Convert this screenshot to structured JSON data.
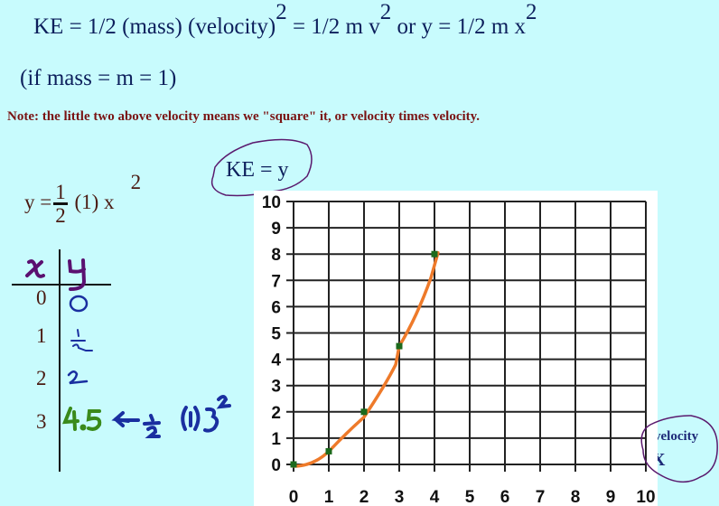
{
  "header": {
    "equation_parts": [
      "KE = 1/2 (mass)  (velocity)",
      "2",
      " = 1/2  m v",
      "2",
      "  or  y = 1/2 m x",
      "2"
    ],
    "condition": "(if mass = m = 1)",
    "note": "Note: the little two above velocity means we \"square\" it, or velocity times velocity."
  },
  "formula": {
    "lhs": "y =",
    "numerator": "1",
    "denominator": "2",
    "rest": "(1) x",
    "exponent": "2"
  },
  "table": {
    "headers": [
      "x",
      "y"
    ],
    "rows": [
      {
        "x": "0",
        "y": "0"
      },
      {
        "x": "1",
        "y": "1/2"
      },
      {
        "x": "2",
        "y": "2"
      },
      {
        "x": "3",
        "y": "4.5"
      }
    ],
    "annotation": "← ½ (1) 3²"
  },
  "colors": {
    "background": "#c8fbfd",
    "curve": "#ee7a2a",
    "points": "#1c6a1c",
    "circle": "#5a1a6e",
    "handwriting_purple": "#5a1070",
    "handwriting_blue": "#1a2fa0",
    "handwriting_green": "#3a8a1a"
  },
  "annotations": {
    "y_axis_label": "KE = y",
    "x_axis_label_top": "velocity",
    "x_axis_label_bottom": "X"
  },
  "chart_data": {
    "type": "scatter",
    "title": "",
    "xlabel": "velocity X",
    "ylabel": "KE = y",
    "x_ticks": [
      "0",
      "1",
      "2",
      "3",
      "4",
      "5",
      "6",
      "7",
      "8",
      "9",
      "10"
    ],
    "y_ticks": [
      "0",
      "1",
      "2",
      "3",
      "4",
      "5",
      "6",
      "7",
      "8",
      "9",
      "10"
    ],
    "xlim": [
      0,
      10
    ],
    "ylim": [
      0,
      10
    ],
    "grid": true,
    "series": [
      {
        "name": "points",
        "x": [
          0,
          1,
          2,
          3,
          4
        ],
        "y": [
          0,
          0.5,
          2,
          4.5,
          8
        ]
      },
      {
        "name": "hand-drawn curve",
        "x": [
          0,
          1,
          2,
          3,
          4
        ],
        "y": [
          0,
          0.5,
          2,
          4.5,
          8
        ]
      }
    ]
  }
}
